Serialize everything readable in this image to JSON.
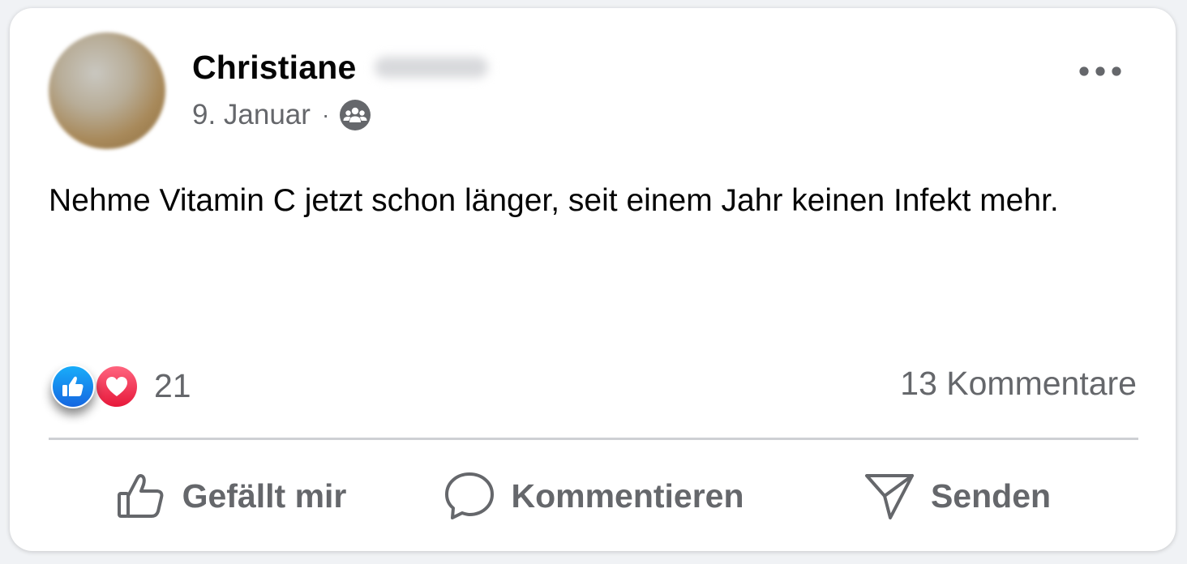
{
  "post": {
    "author": "Christiane",
    "date": "9. Januar",
    "separator": "·",
    "audience_icon": "group-icon",
    "text": "Nehme Vitamin C jetzt schon länger, seit einem Jahr keinen Infekt mehr."
  },
  "stats": {
    "reaction_count": "21",
    "reaction_icons": [
      "like-reaction-icon",
      "love-reaction-icon"
    ],
    "comments": "13 Kommentare"
  },
  "actions": {
    "like_label": "Gefällt mir",
    "comment_label": "Kommentieren",
    "share_label": "Senden"
  },
  "colors": {
    "text_primary": "#050505",
    "text_secondary": "#65676b",
    "like_blue": "#1877f2",
    "love_red": "#f33e58",
    "divider": "#ced0d4"
  }
}
